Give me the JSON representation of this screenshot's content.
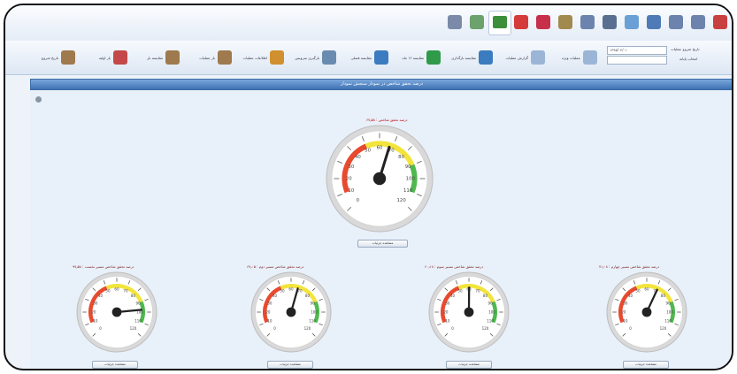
{
  "toolbar": {
    "icons": [
      {
        "name": "close-icon",
        "color": "#c94040"
      },
      {
        "name": "edit-icon",
        "color": "#6c84ad"
      },
      {
        "name": "edit-icon",
        "color": "#6c84ad"
      },
      {
        "name": "users-icon",
        "color": "#4e7bb7"
      },
      {
        "name": "globe-icon",
        "color": "#6aa0d6"
      },
      {
        "name": "bookmark-icon",
        "color": "#5a6e8f"
      },
      {
        "name": "document-icon",
        "color": "#6c84ad"
      },
      {
        "name": "folders-icon",
        "color": "#a28a4e"
      },
      {
        "name": "report-icon",
        "color": "#c82f4a"
      },
      {
        "name": "stop-icon",
        "color": "#d53b3b"
      },
      {
        "name": "chart-icon",
        "color": "#3b8f3b",
        "active": true
      },
      {
        "name": "settings-icon",
        "color": "#6ca26c"
      },
      {
        "name": "pen-icon",
        "color": "#7a8aa8"
      }
    ]
  },
  "ribbon": {
    "items": [
      {
        "icon": "report-icon",
        "color": "#9bb5d6",
        "label": "عملیات ویژه"
      },
      {
        "icon": "report-icon",
        "color": "#9bb5d6",
        "label": "گزارش عملیات"
      },
      {
        "icon": "globe-icon",
        "color": "#3b7bbf",
        "label": "مقایسه بارگذاری"
      },
      {
        "icon": "chart-icon",
        "color": "#2f9a4a",
        "label": "مقایسه ۱۲ ماه"
      },
      {
        "icon": "cube-icon",
        "color": "#3b7bbf",
        "label": "مقایسه فصلی"
      },
      {
        "icon": "truck-icon",
        "color": "#6a8bb0",
        "label": "بارگیری سرویس"
      },
      {
        "icon": "chart-icon",
        "color": "#d0902f",
        "label": "اطلاعات عملیات"
      },
      {
        "icon": "person-icon",
        "color": "#9e7a4e",
        "label": "بار عملیات"
      },
      {
        "icon": "person-icon",
        "color": "#9e7a4e",
        "label": "مقایسه بار"
      },
      {
        "icon": "calendar-icon",
        "color": "#c4484a",
        "label": "بار اولیه"
      },
      {
        "icon": "person-icon",
        "color": "#9e7a4e",
        "label": "تاریخ شروع"
      }
    ],
    "date_field": "۱۳۹۵/۰۴/۰۱",
    "date_label": "تاریخ شروع عملیات",
    "filter_label": "انتخاب پایانه"
  },
  "panel": {
    "title": "درصد تحقق شاخص در نمودار سنجش نمودار"
  },
  "gauges": {
    "main": {
      "title": "درصد تحقق شاخص : ۶۷٫۵۸",
      "value": 67.58,
      "button": "مشاهده جزئیات"
    },
    "small": [
      {
        "title": "درصد تحقق شاخص مسیر نخست : ۹۷٫۵۸",
        "value": 97.58,
        "button": "مشاهده جزئیات"
      },
      {
        "title": "درصد تحقق شاخص مسیر دوم : ۶۷٫۰۵",
        "value": 67.05,
        "button": "مشاهده جزئیات"
      },
      {
        "title": "درصد تحقق شاخص مسیر سوم : ۶۰٫۱۸",
        "value": 60.18,
        "button": "مشاهده جزئیات"
      },
      {
        "title": "درصد تحقق شاخص مسیر چهارم : ۷۱٫۰۸",
        "value": 71.08,
        "button": "مشاهده جزئیات"
      }
    ],
    "scale": {
      "min": 0,
      "max": 120,
      "ticks": [
        "0",
        "10",
        "20",
        "30",
        "40",
        "50",
        "60",
        "70",
        "80",
        "90",
        "100",
        "110",
        "120"
      ]
    },
    "colors": {
      "red": "#e84a2f",
      "yellow": "#f2e43a",
      "green": "#4fb84f",
      "needle": "#222222",
      "face": "#ffffff",
      "rim": "#d9d9d9"
    }
  }
}
